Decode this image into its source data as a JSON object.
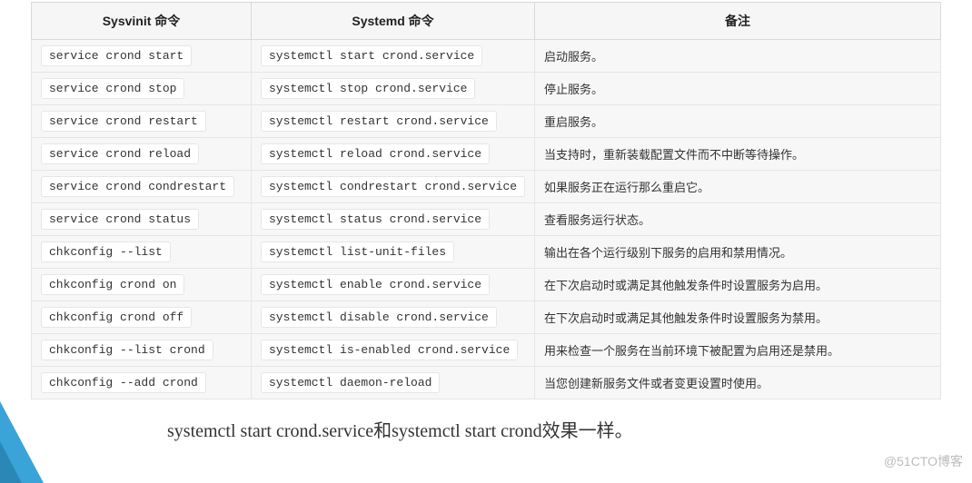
{
  "table": {
    "headers": {
      "sysvinit": "Sysvinit 命令",
      "systemd": "Systemd 命令",
      "remark": "备注"
    },
    "rows": [
      {
        "sysv": "service crond start",
        "sysd": "systemctl start crond.service",
        "desc": "启动服务。"
      },
      {
        "sysv": "service crond stop",
        "sysd": "systemctl stop crond.service",
        "desc": "停止服务。"
      },
      {
        "sysv": "service crond restart",
        "sysd": "systemctl restart crond.service",
        "desc": "重启服务。"
      },
      {
        "sysv": "service crond reload",
        "sysd": "systemctl reload crond.service",
        "desc": "当支持时，重新装载配置文件而不中断等待操作。"
      },
      {
        "sysv": "service crond condrestart",
        "sysd": "systemctl condrestart crond.service",
        "desc": "如果服务正在运行那么重启它。"
      },
      {
        "sysv": "service crond status",
        "sysd": "systemctl status crond.service",
        "desc": "查看服务运行状态。"
      },
      {
        "sysv": "chkconfig --list",
        "sysd": "systemctl list-unit-files",
        "desc": "输出在各个运行级别下服务的启用和禁用情况。"
      },
      {
        "sysv": "chkconfig crond on",
        "sysd": "systemctl enable crond.service",
        "desc": "在下次启动时或满足其他触发条件时设置服务为启用。"
      },
      {
        "sysv": "chkconfig crond off",
        "sysd": "systemctl disable crond.service",
        "desc": "在下次启动时或满足其他触发条件时设置服务为禁用。"
      },
      {
        "sysv": "chkconfig --list crond",
        "sysd": "systemctl is-enabled crond.service",
        "desc": "用来检查一个服务在当前环境下被配置为启用还是禁用。"
      },
      {
        "sysv": "chkconfig --add crond",
        "sysd": "systemctl daemon-reload",
        "desc": "当您创建新服务文件或者变更设置时使用。"
      }
    ]
  },
  "footer_note": "systemctl start crond.service和systemctl start crond效果一样。",
  "watermark": "@51CTO博客"
}
